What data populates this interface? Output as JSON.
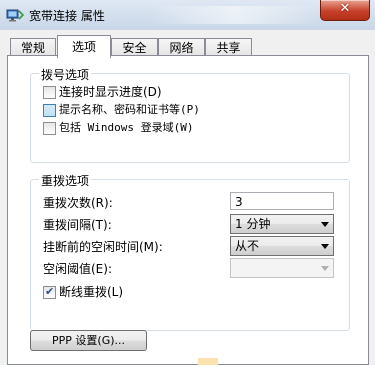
{
  "window": {
    "title": "宽带连接 属性",
    "close_label": "✕"
  },
  "tabs": [
    {
      "label": "常规",
      "active": false
    },
    {
      "label": "选项",
      "active": true
    },
    {
      "label": "安全",
      "active": false
    },
    {
      "label": "网络",
      "active": false
    },
    {
      "label": "共享",
      "active": false
    }
  ],
  "dial_options": {
    "title": "拨号选项",
    "items": [
      {
        "label": "连接时显示进度(D)",
        "checked": false
      },
      {
        "label": "提示名称、密码和证书等(P)",
        "checked": false
      },
      {
        "label": "包括 Windows 登录域(W)",
        "checked": false
      }
    ]
  },
  "redial_options": {
    "title": "重拨选项",
    "attempts_label": "重拨次数(R):",
    "attempts_value": "3",
    "interval_label": "重拨间隔(T):",
    "interval_value": "1 分钟",
    "idle_time_label": "挂断前的空闲时间(M):",
    "idle_time_value": "从不",
    "idle_threshold_label": "空闲阈值(E):",
    "idle_threshold_value": "",
    "redial_on_drop_label": "断线重拨(L)",
    "redial_on_drop_checked": true
  },
  "ppp_button_label": "PPP 设置(G)...",
  "colors": {
    "close_button": "#c7422b",
    "titlebar": "#dfe8f3",
    "group_border": "#d5dfe5"
  }
}
